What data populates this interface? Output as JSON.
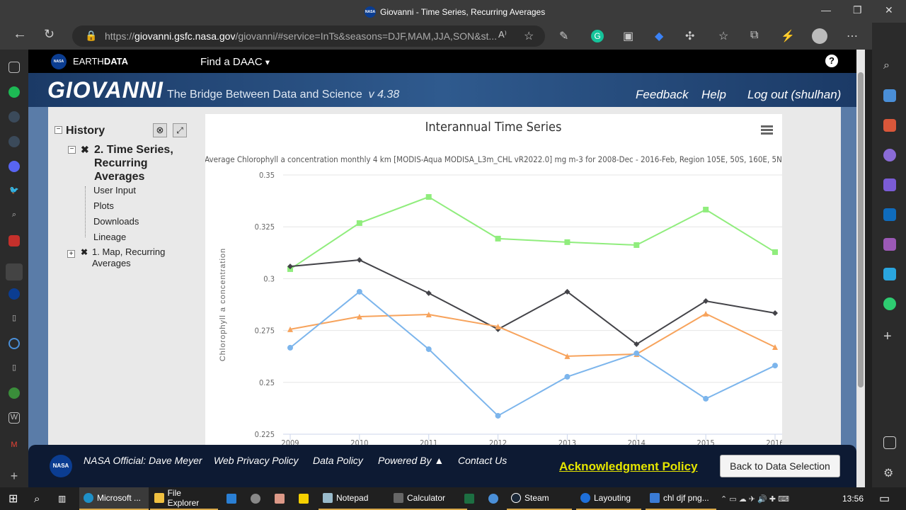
{
  "browser": {
    "title": "Giovanni - Time Series, Recurring Averages",
    "url_prefix": "https://",
    "url_host": "giovanni.gsfc.nasa.gov",
    "url_rest": "/giovanni/#service=InTs&seasons=DJF,MAM,JJA,SON&st...",
    "reader_icon": "A⁾"
  },
  "earthdata": {
    "brand_light": "EARTH",
    "brand_bold": "DATA",
    "find_daac": "Find a DAAC",
    "help": "?"
  },
  "banner": {
    "logo": "GIOVANNI",
    "tagline": "The Bridge Between Data and Science",
    "version": "v 4.38",
    "links": [
      "Feedback",
      "Help",
      "Log out (shulhan)"
    ]
  },
  "history": {
    "title": "History",
    "item2_title": "2. Time Series, Recurring Averages",
    "item2_children": [
      "User Input",
      "Plots",
      "Downloads",
      "Lineage"
    ],
    "item1_title": "1. Map, Recurring Averages"
  },
  "footer": {
    "official": "NASA Official: Dave Meyer",
    "links": [
      "Web Privacy Policy",
      "Data Policy",
      "Powered By ▲",
      "Contact Us"
    ],
    "ack": "Acknowledgment Policy",
    "back": "Back to Data Selection"
  },
  "taskbar": {
    "apps": [
      "Microsoft ...",
      "File Explorer",
      "Notepad",
      "Calculator",
      "Steam",
      "Layouting",
      "chl djf png..."
    ],
    "time": "13:56"
  },
  "chart_data": {
    "type": "line",
    "title": "Interannual Time Series",
    "subtitle": "Average Chlorophyll a concentration monthly 4 km [MODIS-Aqua MODISA_L3m_CHL vR2022.0] mg m-3 for 2008-Dec - 2016-Feb, Region 105E, 50S, 160E, 5N",
    "ylabel": "Chlorophyll a concentration",
    "xlabel": "",
    "x": [
      "2009",
      "2010",
      "2011",
      "2012",
      "2013",
      "2014",
      "2015",
      "2016"
    ],
    "ylim": [
      0.225,
      0.35
    ],
    "yticks": [
      "0.35",
      "0.325",
      "0.3",
      "0.275",
      "0.25",
      "0.225"
    ],
    "grid": true,
    "series": [
      {
        "color": "#90ed7d",
        "marker": "square",
        "values": [
          0.3046,
          0.3268,
          0.3394,
          0.3193,
          0.3176,
          0.3162,
          0.3333,
          0.3128
        ]
      },
      {
        "color": "#434348",
        "marker": "diamond",
        "values": [
          0.3059,
          0.309,
          0.293,
          0.2756,
          0.2937,
          0.2684,
          0.2892,
          0.2834
        ]
      },
      {
        "color": "#f7a35c",
        "marker": "triangle",
        "values": [
          0.2756,
          0.2817,
          0.2827,
          0.2769,
          0.2626,
          0.2636,
          0.2831,
          0.267
        ]
      },
      {
        "color": "#7cb5ec",
        "marker": "circle",
        "values": [
          0.2667,
          0.2937,
          0.266,
          0.2339,
          0.2527,
          0.264,
          0.2421,
          0.2581
        ]
      }
    ]
  }
}
